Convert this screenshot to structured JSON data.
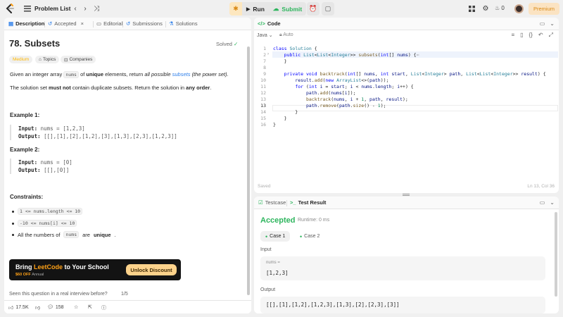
{
  "topbar": {
    "problem_list": "Problem List",
    "run": "Run",
    "submit": "Submit",
    "streak": "0",
    "premium": "Premium"
  },
  "tabs": {
    "description": "Description",
    "accepted": "Accepted",
    "editorial": "Editorial",
    "submissions": "Submissions",
    "solutions": "Solutions"
  },
  "problem": {
    "title": "78. Subsets",
    "status": "Solved",
    "difficulty": "Medium",
    "topics": "Topics",
    "companies": "Companies",
    "p1_a": "Given an integer array",
    "p1_code": "nums",
    "p1_b": "of",
    "p1_bold": "unique",
    "p1_c": "elements, return",
    "p1_italic": "all possible",
    "p1_link": "subsets",
    "p1_d": "(the power set).",
    "p2_a": "The solution set",
    "p2_bold": "must not",
    "p2_b": "contain duplicate subsets. Return the solution in",
    "p2_bold2": "any order",
    "p2_c": ".",
    "examples": [
      {
        "title": "Example 1:",
        "input_label": "Input:",
        "input": "nums = [1,2,3]",
        "output_label": "Output:",
        "output": "[[],[1],[2],[1,2],[3],[1,3],[2,3],[1,2,3]]"
      },
      {
        "title": "Example 2:",
        "input_label": "Input:",
        "input": "nums = [0]",
        "output_label": "Output:",
        "output": "[[],[0]]"
      }
    ],
    "constraints_title": "Constraints:",
    "constraints": [
      "1 <= nums.length <= 10",
      "-10 <= nums[i] <= 10"
    ],
    "c3_a": "All the numbers of",
    "c3_code": "nums",
    "c3_b": "are",
    "c3_bold": "unique",
    "c3_c": "."
  },
  "promo": {
    "title_a": "Bring",
    "title_brand": "LeetCode",
    "title_b": "to Your School",
    "sub_a": "$60 OFF",
    "sub_b": "Annual",
    "button": "Unlock Discount"
  },
  "seen": {
    "question": "Seen this question in a real interview before?",
    "count": "1/5"
  },
  "footer": {
    "likes": "17.5K",
    "comments": "158"
  },
  "code": {
    "title": "Code",
    "language": "Java",
    "auto": "Auto",
    "saved": "Saved",
    "position": "Ln 13, Col 36"
  },
  "result": {
    "testcase_tab": "Testcase",
    "result_tab": "Test Result",
    "status": "Accepted",
    "runtime": "Runtime: 0 ms",
    "case1": "Case 1",
    "case2": "Case 2",
    "input_label": "Input",
    "input_var": "nums =",
    "input_val": "[1,2,3]",
    "output_label": "Output",
    "output_val": "[[],[1],[1,2],[1,2,3],[1,3],[2],[2,3],[3]]"
  },
  "colors": {
    "accent_green": "#2db55d",
    "medium": "#ffb800",
    "brand_orange": "#ffa116"
  }
}
